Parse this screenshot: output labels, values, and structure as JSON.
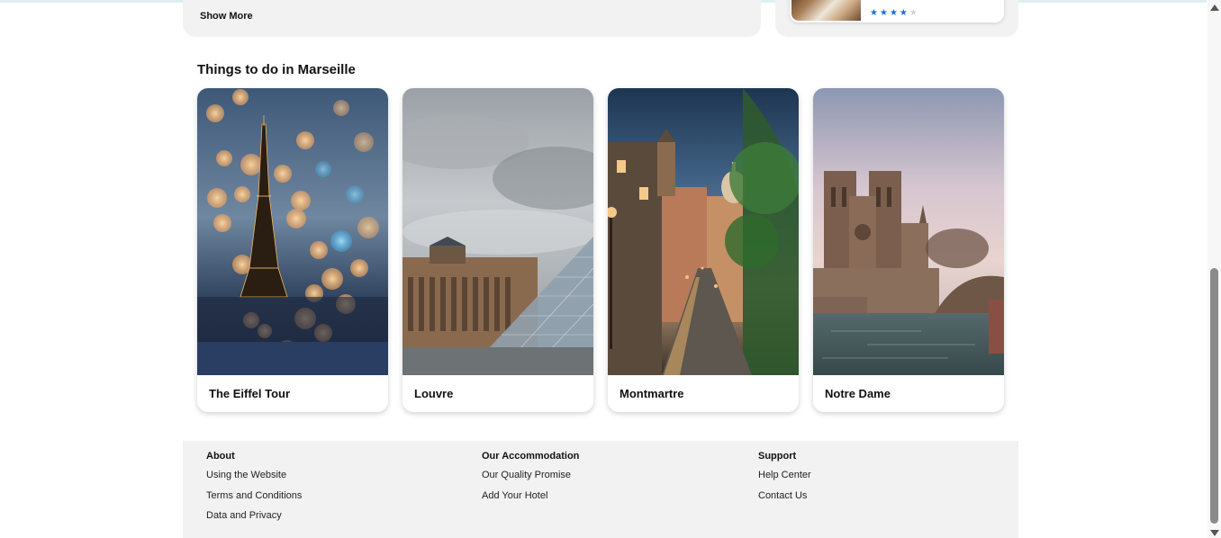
{
  "top": {
    "show_more_label": "Show More",
    "hotel_rating": 4,
    "hotel_rating_max": 5
  },
  "things_to_do": {
    "title": "Things to do in Marseille",
    "cards": [
      {
        "label": "The Eiffel Tour",
        "image": "eiffel-tower-image"
      },
      {
        "label": "Louvre",
        "image": "louvre-image"
      },
      {
        "label": "Montmartre",
        "image": "montmartre-image"
      },
      {
        "label": "Notre Dame",
        "image": "notre-dame-image"
      }
    ]
  },
  "footer": {
    "about": {
      "heading": "About",
      "links": [
        "Using the Website",
        "Terms and Conditions",
        "Data and Privacy"
      ]
    },
    "accommodation": {
      "heading": "Our Accommodation",
      "links": [
        "Our Quality Promise",
        "Add Your Hotel"
      ]
    },
    "support": {
      "heading": "Support",
      "links": [
        "Help Center",
        "Contact Us"
      ]
    }
  },
  "colors": {
    "star_active": "#1a6fe0",
    "star_inactive": "#cfd3d8",
    "panel_bg": "#f2f2f2"
  }
}
